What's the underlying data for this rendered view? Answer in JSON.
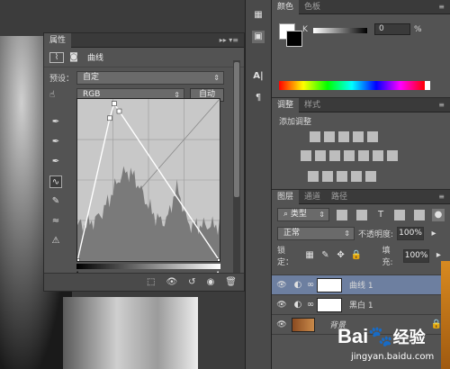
{
  "properties": {
    "tab_label": "属性",
    "menu_icon": "panel-menu-icon",
    "layer_name": "曲线",
    "preset_label": "预设：",
    "preset_value": "自定",
    "channel_value": "RGB",
    "auto_label": "自动"
  },
  "color_panel": {
    "tabs": [
      "颜色",
      "色板"
    ],
    "channel_letter": "K",
    "value": "0",
    "unit": "%",
    "slider_level": 0
  },
  "adjustments": {
    "tabs": [
      "调整",
      "样式"
    ],
    "add_label": "添加调整"
  },
  "layers": {
    "tabs": [
      "图层",
      "通道",
      "路径"
    ],
    "filter_value": "类型",
    "blend_mode": "正常",
    "opacity_label": "不透明度:",
    "opacity_value": "100%",
    "lock_label": "锁定：",
    "fill_label": "填充:",
    "fill_value": "100%",
    "items": [
      {
        "name": "曲线 1",
        "selected": true
      },
      {
        "name": "黑白 1",
        "selected": false
      },
      {
        "name": "背景",
        "selected": false
      }
    ]
  },
  "watermark": {
    "brand": "Bai",
    "brand2": "经验",
    "url": "jingyan.baidu.com"
  },
  "colors": {
    "panel": "#535353",
    "dark": "#3a3a3a",
    "selected": "#6d7fa0"
  },
  "curve": {
    "points": [
      [
        0,
        0
      ],
      [
        58,
        225
      ],
      [
        66,
        248
      ],
      [
        75,
        236
      ],
      [
        255,
        0
      ]
    ]
  }
}
